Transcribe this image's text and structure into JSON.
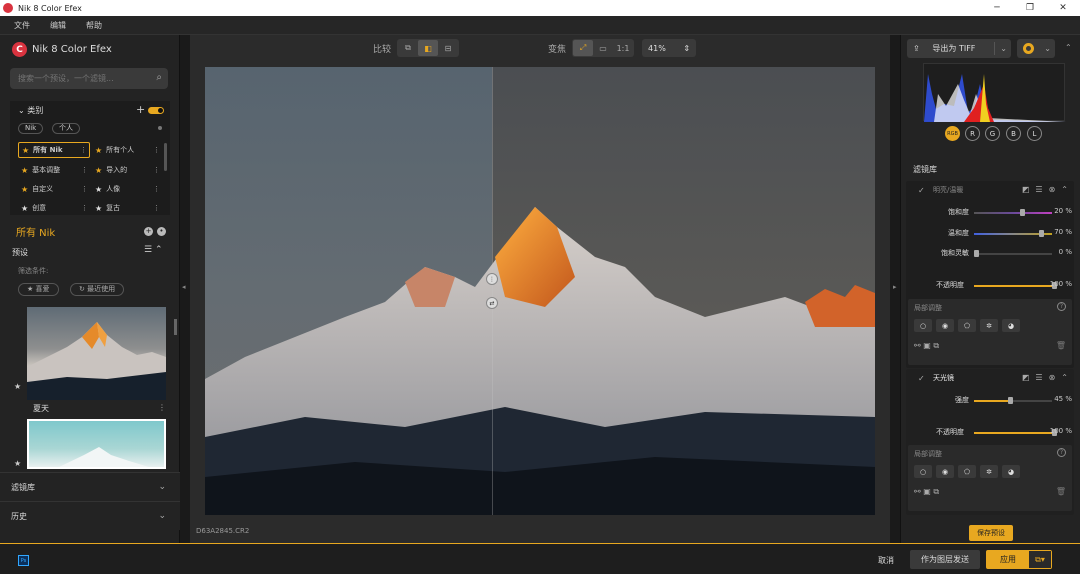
{
  "window": {
    "title": "Nik 8 Color Efex",
    "min": "─",
    "max": "❐",
    "close": "✕"
  },
  "menu": [
    "文件",
    "编辑",
    "帮助"
  ],
  "left": {
    "brand": "Nik 8 Color Efex",
    "brand_mark": "C",
    "search_placeholder": "搜索一个预设，一个滤镜...",
    "categories_title": "类别",
    "chips": [
      "Nik",
      "个人"
    ],
    "categories": [
      {
        "label": "所有 Nik",
        "star": "filled"
      },
      {
        "label": "所有个人",
        "star": "filled"
      },
      {
        "label": "基本调整",
        "star": "filled"
      },
      {
        "label": "导入的",
        "star": "filled"
      },
      {
        "label": "自定义",
        "star": "filled"
      },
      {
        "label": "人像",
        "star": "empty"
      },
      {
        "label": "创意",
        "star": "empty"
      },
      {
        "label": "复古",
        "star": "empty"
      }
    ],
    "current_collection": "所有 Nik",
    "presets_title": "预设",
    "filter_label": "筛选条件:",
    "filter_pills": [
      "喜爱",
      "最近使用"
    ],
    "thumb1_label": "夏天",
    "accordions": [
      "滤镜库",
      "历史"
    ]
  },
  "center": {
    "compare_label": "比较",
    "zoom_label": "变焦",
    "zoom_1to1": "1:1",
    "zoom_value": "41%",
    "filename": "D63A2845.CR2"
  },
  "right": {
    "export_label": "导出为 TIFF",
    "channels": [
      "RGB",
      "R",
      "G",
      "B",
      "L"
    ],
    "library_title": "滤镜库",
    "filter1": {
      "name": "明亮/温暖",
      "sliders": [
        {
          "label": "饱和度",
          "value": "20 %",
          "pos": 0.6
        },
        {
          "label": "温和度",
          "value": "70 %",
          "pos": 0.85
        },
        {
          "label": "饱和灵敏",
          "value": "0 %",
          "pos": 0.0
        }
      ],
      "opacity_label": "不透明度",
      "opacity_value": "100 %",
      "local_title": "局部调整"
    },
    "filter2": {
      "name": "天光镜",
      "sliders": [
        {
          "label": "强度",
          "value": "45 %",
          "pos": 0.45
        }
      ],
      "opacity_label": "不透明度",
      "opacity_value": "100 %",
      "local_title": "局部调整"
    },
    "save_preset": "保存预设"
  },
  "bottom": {
    "ps_label": "Ps",
    "cancel": "取消",
    "send_as_layer": "作为图层发送",
    "apply": "应用"
  },
  "colors": {
    "accent": "#e8a820",
    "brand": "#d9333f"
  }
}
